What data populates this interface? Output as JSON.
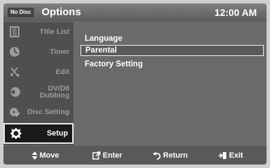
{
  "header": {
    "badge": "No Disc",
    "title": "Options",
    "time": "12:00 AM"
  },
  "sidebar": {
    "items": [
      {
        "label": "Title List",
        "icon": "film-icon"
      },
      {
        "label": "Timer",
        "icon": "timer-icon"
      },
      {
        "label": "Edit",
        "icon": "scissors-icon"
      },
      {
        "label": "DV/D8 Dubbing",
        "icon": "dubbing-icon"
      },
      {
        "label": "Disc Setting",
        "icon": "disc-icon"
      },
      {
        "label": "Setup",
        "icon": "gear-icon"
      }
    ],
    "active": "Setup"
  },
  "menu": {
    "items": [
      "Language",
      "Parental",
      "Factory Setting"
    ],
    "selected": "Parental"
  },
  "footer": {
    "move": "Move",
    "enter": "Enter",
    "return": "Return",
    "exit": "Exit"
  },
  "colors": {
    "frame": "#6b6b6b",
    "sidebar": "#4f4f4f",
    "active_item": "#1a1a1a",
    "text": "#ffffff",
    "inactive_text": "#9c9c9c"
  }
}
